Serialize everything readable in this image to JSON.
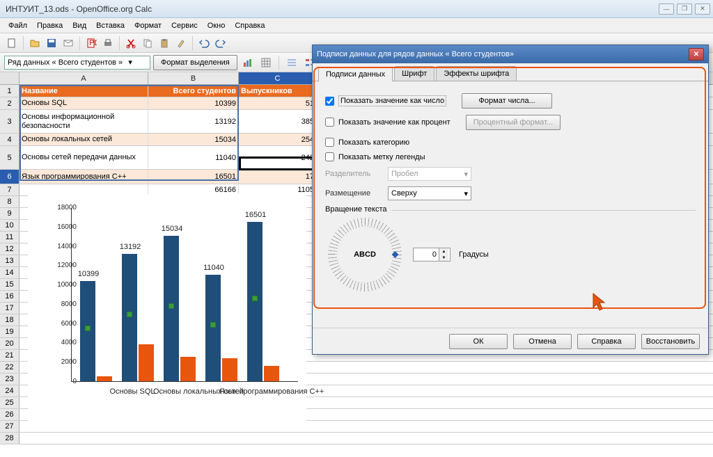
{
  "window": {
    "title": "ИНТУИТ_13.ods - OpenOffice.org Calc"
  },
  "menu": {
    "file": "Файл",
    "edit": "Правка",
    "view": "Вид",
    "insert": "Вставка",
    "format": "Формат",
    "service": "Сервис",
    "window": "Окно",
    "help": "Справка"
  },
  "toolbar2": {
    "series_combo": "Ряд данных « Всего студентов »",
    "format_selection": "Формат выделения"
  },
  "columns": {
    "A": "A",
    "B": "B",
    "C": "C"
  },
  "table": {
    "header": {
      "name": "Название",
      "total": "Всего студентов",
      "grad": "Выпускников"
    },
    "rows": [
      {
        "name": "Основы SQL",
        "total": "10399",
        "grad": "51"
      },
      {
        "name": "Основы информационной безопасности",
        "total": "13192",
        "grad": "385"
      },
      {
        "name": "Основы локальных сетей",
        "total": "15034",
        "grad": "254"
      },
      {
        "name": "Основы сетей передачи данных",
        "total": "11040",
        "grad": "242"
      },
      {
        "name": "Язык программирования С++",
        "total": "16501",
        "grad": "17"
      },
      {
        "name": "",
        "total": "66166",
        "grad": "1105"
      }
    ]
  },
  "chart_data": {
    "type": "bar",
    "categories": [
      "Основы SQL",
      "Основы информационной безопасности",
      "Основы локальных сетей",
      "Основы сетей передачи данных",
      "Язык программирования С++"
    ],
    "series": [
      {
        "name": "Всего студентов",
        "values": [
          10399,
          13192,
          15034,
          11040,
          16501
        ]
      },
      {
        "name": "Выпускников",
        "values": [
          500,
          3800,
          2500,
          2400,
          1600
        ]
      }
    ],
    "ylim": [
      0,
      18000
    ],
    "ytick": 2000,
    "xlabels_visible": [
      "Основы SQL",
      "Основы локальных сетей",
      "Язык программирования С++"
    ]
  },
  "dialog": {
    "title": "Подписи данных для рядов данных « Всего студентов»",
    "tabs": {
      "labels": "Подписи данных",
      "font": "Шрифт",
      "effects": "Эффекты шрифта"
    },
    "show_number": "Показать значение как число",
    "number_format": "Формат числа...",
    "show_percent": "Показать значение как процент",
    "percent_format": "Процентный формат...",
    "show_category": "Показать категорию",
    "show_legend": "Показать метку легенды",
    "separator": "Разделитель",
    "separator_val": "Пробел",
    "placement": "Размещение",
    "placement_val": "Сверху",
    "rotation": "Вращение текста",
    "abcd": "ABCD",
    "degrees": "0",
    "degrees_lbl": "Градусы",
    "ok": "ОК",
    "cancel": "Отмена",
    "help": "Справка",
    "restore": "Восстановить"
  }
}
